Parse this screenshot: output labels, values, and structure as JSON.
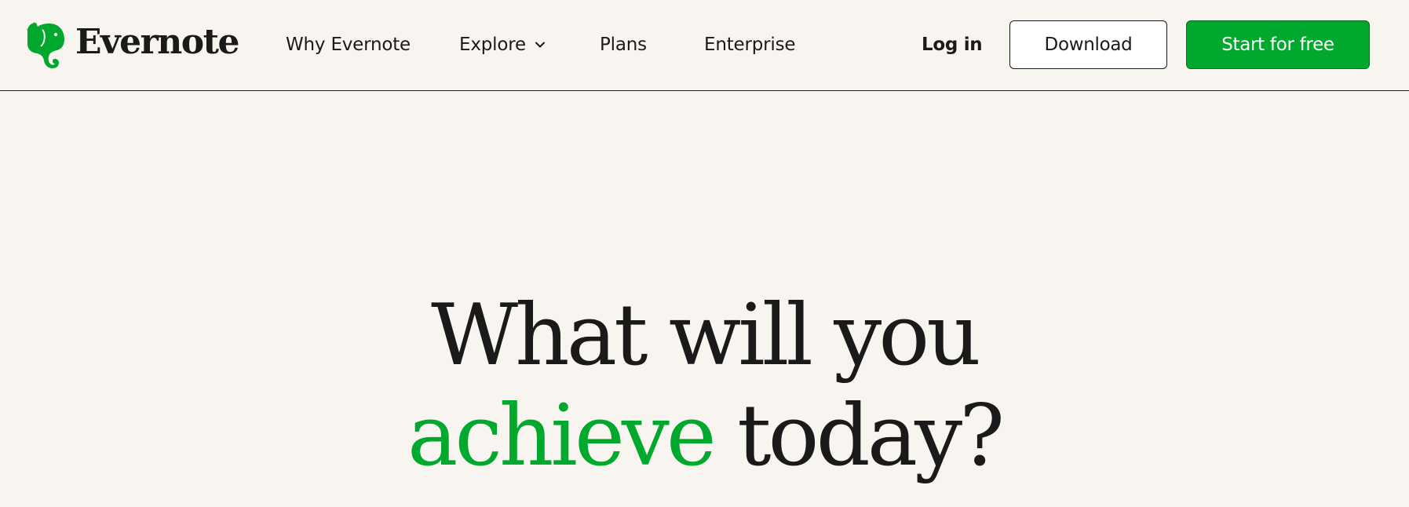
{
  "brand": {
    "name": "Evernote",
    "accent_color": "#00a82d",
    "logo_icon": "elephant-icon"
  },
  "nav": {
    "why": "Why Evernote",
    "explore": "Explore",
    "explore_icon": "chevron-down-icon",
    "plans": "Plans",
    "enterprise": "Enterprise"
  },
  "actions": {
    "login": "Log in",
    "download": "Download",
    "start": "Start for free"
  },
  "hero": {
    "line1": "What will you",
    "accent_word": "achieve",
    "line2_rest": "today?"
  }
}
